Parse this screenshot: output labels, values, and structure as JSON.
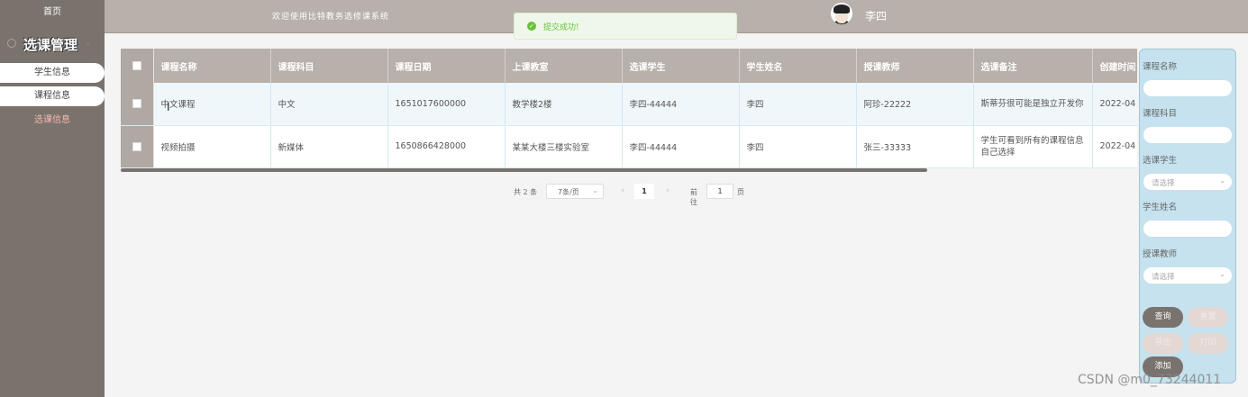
{
  "sidebar": {
    "home": "首页",
    "menu_title": "选课管理",
    "items": [
      {
        "label": "学生信息",
        "state": "pill"
      },
      {
        "label": "课程信息",
        "state": "pill"
      },
      {
        "label": "选课信息",
        "state": "active"
      }
    ]
  },
  "header": {
    "welcome": "欢迎使用比特教务选修课系统",
    "username": "李四"
  },
  "toast": {
    "text": "提交成功!",
    "icon": "check-circle-icon",
    "color": "#67c23a"
  },
  "table": {
    "columns": [
      "课程名称",
      "课程科目",
      "课程日期",
      "上课教室",
      "选课学生",
      "学生姓名",
      "授课教师",
      "选课备注",
      "创建时间"
    ],
    "rows": [
      [
        "中文课程",
        "中文",
        "1651017600000",
        "教学楼2楼",
        "李四-44444",
        "李四",
        "阿珍-22222",
        "斯蒂芬很可能是独立开发你",
        "2022-04"
      ],
      [
        "视频拍摄",
        "新媒体",
        "1650866428000",
        "某某大楼三楼实验室",
        "李四-44444",
        "李四",
        "张三-33333",
        "学生可看到所有的课程信息自己选择",
        "2022-04"
      ]
    ]
  },
  "pagination": {
    "total": "共 2 条",
    "page_size": "7条/页",
    "current_page": "1",
    "goto_label": "前往",
    "goto_value": "1",
    "goto_suffix": "页"
  },
  "filter": {
    "course_name_label": "课程名称",
    "course_subject_label": "课程科目",
    "student_label": "选课学生",
    "student_placeholder": "请选择",
    "student_name_label": "学生姓名",
    "teacher_label": "授课教师",
    "teacher_placeholder": "请选择",
    "buttons": {
      "query": "查询",
      "reset": "重置",
      "export": "导出",
      "print": "打印",
      "add": "添加"
    }
  },
  "watermark": "CSDN @m0_73244011",
  "colors": {
    "sidebar": "#7a726d",
    "header": "#b8b0aa",
    "filter_panel": "#c5e2ee",
    "active_menu": "#f4b9b0"
  }
}
